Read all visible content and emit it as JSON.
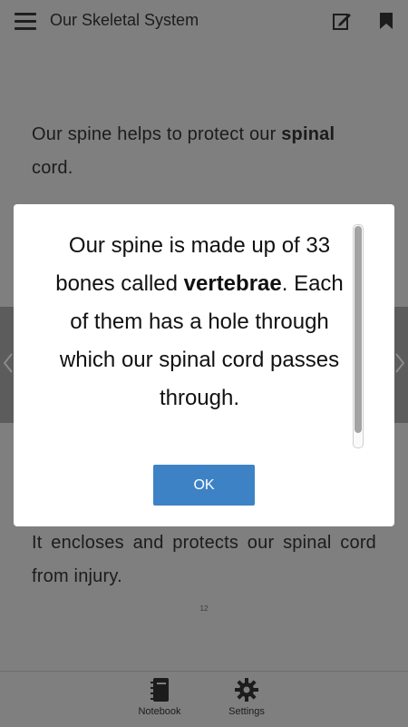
{
  "header": {
    "title": "Our Skeletal System",
    "menu_icon": "hamburger-menu-icon",
    "edit_icon": "edit-note-icon",
    "bookmark_icon": "bookmark-icon"
  },
  "content": {
    "paragraph_top_prefix": "Our spine helps to protect our ",
    "paragraph_top_bold": "spinal",
    "paragraph_top_suffix": "cord.",
    "paragraph_bottom": "It encloses and protects our spinal cord from injury.",
    "page_number": "12"
  },
  "modal": {
    "text_prefix": "Our spine is made up of 33 bones called ",
    "text_bold": "vertebrae",
    "text_suffix": ". Each of them has a hole through which our spinal cord passes through.",
    "ok_label": "OK"
  },
  "bottom_bar": {
    "tabs": [
      {
        "label": "Notebook",
        "icon": "notebook-icon"
      },
      {
        "label": "Settings",
        "icon": "gear-icon"
      }
    ]
  },
  "colors": {
    "overlay_background": "#7f7f7f",
    "modal_background": "#ffffff",
    "ok_button": "#3e82c6"
  }
}
